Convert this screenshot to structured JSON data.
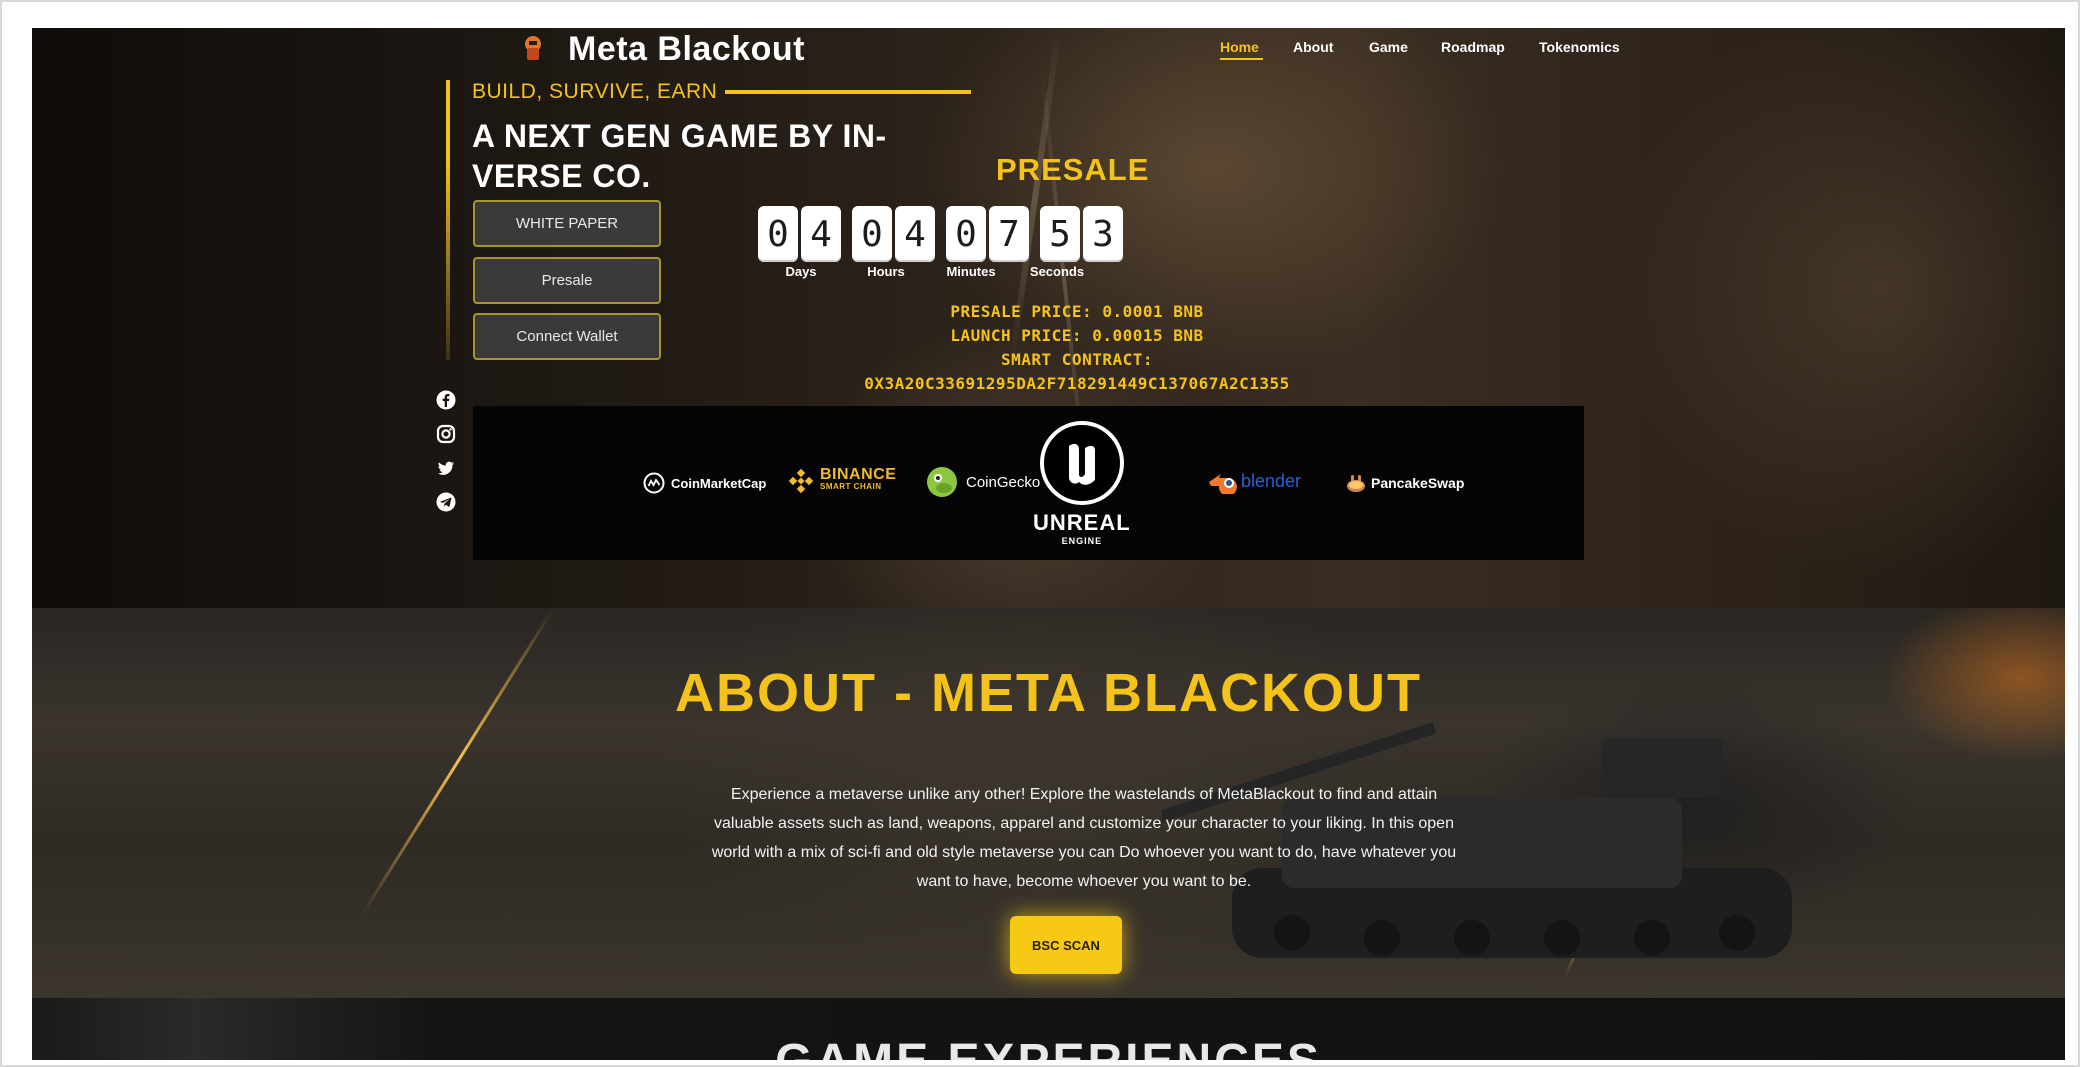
{
  "header": {
    "logo_text": "Meta Blackout",
    "nav": [
      "Home",
      "About",
      "Game",
      "Roadmap",
      "Tokenomics"
    ],
    "active_nav": "Home"
  },
  "hero": {
    "tagline": "BUILD, SURVIVE, EARN",
    "headline": "A NEXT GEN GAME BY IN-VERSE CO.",
    "buttons": {
      "white_paper": "WHITE PAPER",
      "presale": "Presale",
      "connect_wallet": "Connect Wallet"
    },
    "social_icons": [
      "facebook-icon",
      "instagram-icon",
      "twitter-icon",
      "telegram-icon"
    ]
  },
  "presale": {
    "title": "PRESALE",
    "digits": [
      "0",
      "4",
      "0",
      "4",
      "0",
      "7",
      "5",
      "3"
    ],
    "labels": {
      "days": "Days",
      "hours": "Hours",
      "minutes": "Minutes",
      "seconds": "Seconds"
    },
    "presale_price": "PRESALE PRICE: 0.0001 BNB",
    "launch_price": "LAUNCH PRICE: 0.00015 BNB",
    "contract_label": "SMART CONTRACT:",
    "contract_address": "0X3A20C33691295DA2F718291449C137067A2C1355"
  },
  "partners": {
    "coinmarketcap": "CoinMarketCap",
    "binance_main": "BINANCE",
    "binance_sub": "SMART CHAIN",
    "coingecko": "CoinGecko",
    "unreal_main": "UNREAL",
    "unreal_sub": "ENGINE",
    "blender": "blender",
    "pancakeswap": "PancakeSwap"
  },
  "about": {
    "title": "ABOUT - META BLACKOUT",
    "description": "Experience a metaverse unlike any other! Explore the wastelands of MetaBlackout to find and attain valuable assets such as land, weapons, apparel and customize your character to your liking. In this open world with a mix of sci-fi and old style metaverse you can Do whoever you want to do, have whatever you want to have, become whoever you want to be.",
    "button": "BSC SCAN"
  },
  "next_section": {
    "title": "GAME EXPERIENCES"
  },
  "colors": {
    "accent": "#f3c21b",
    "button_bg": "#3a3a3c",
    "partner_bar": "#050505"
  }
}
